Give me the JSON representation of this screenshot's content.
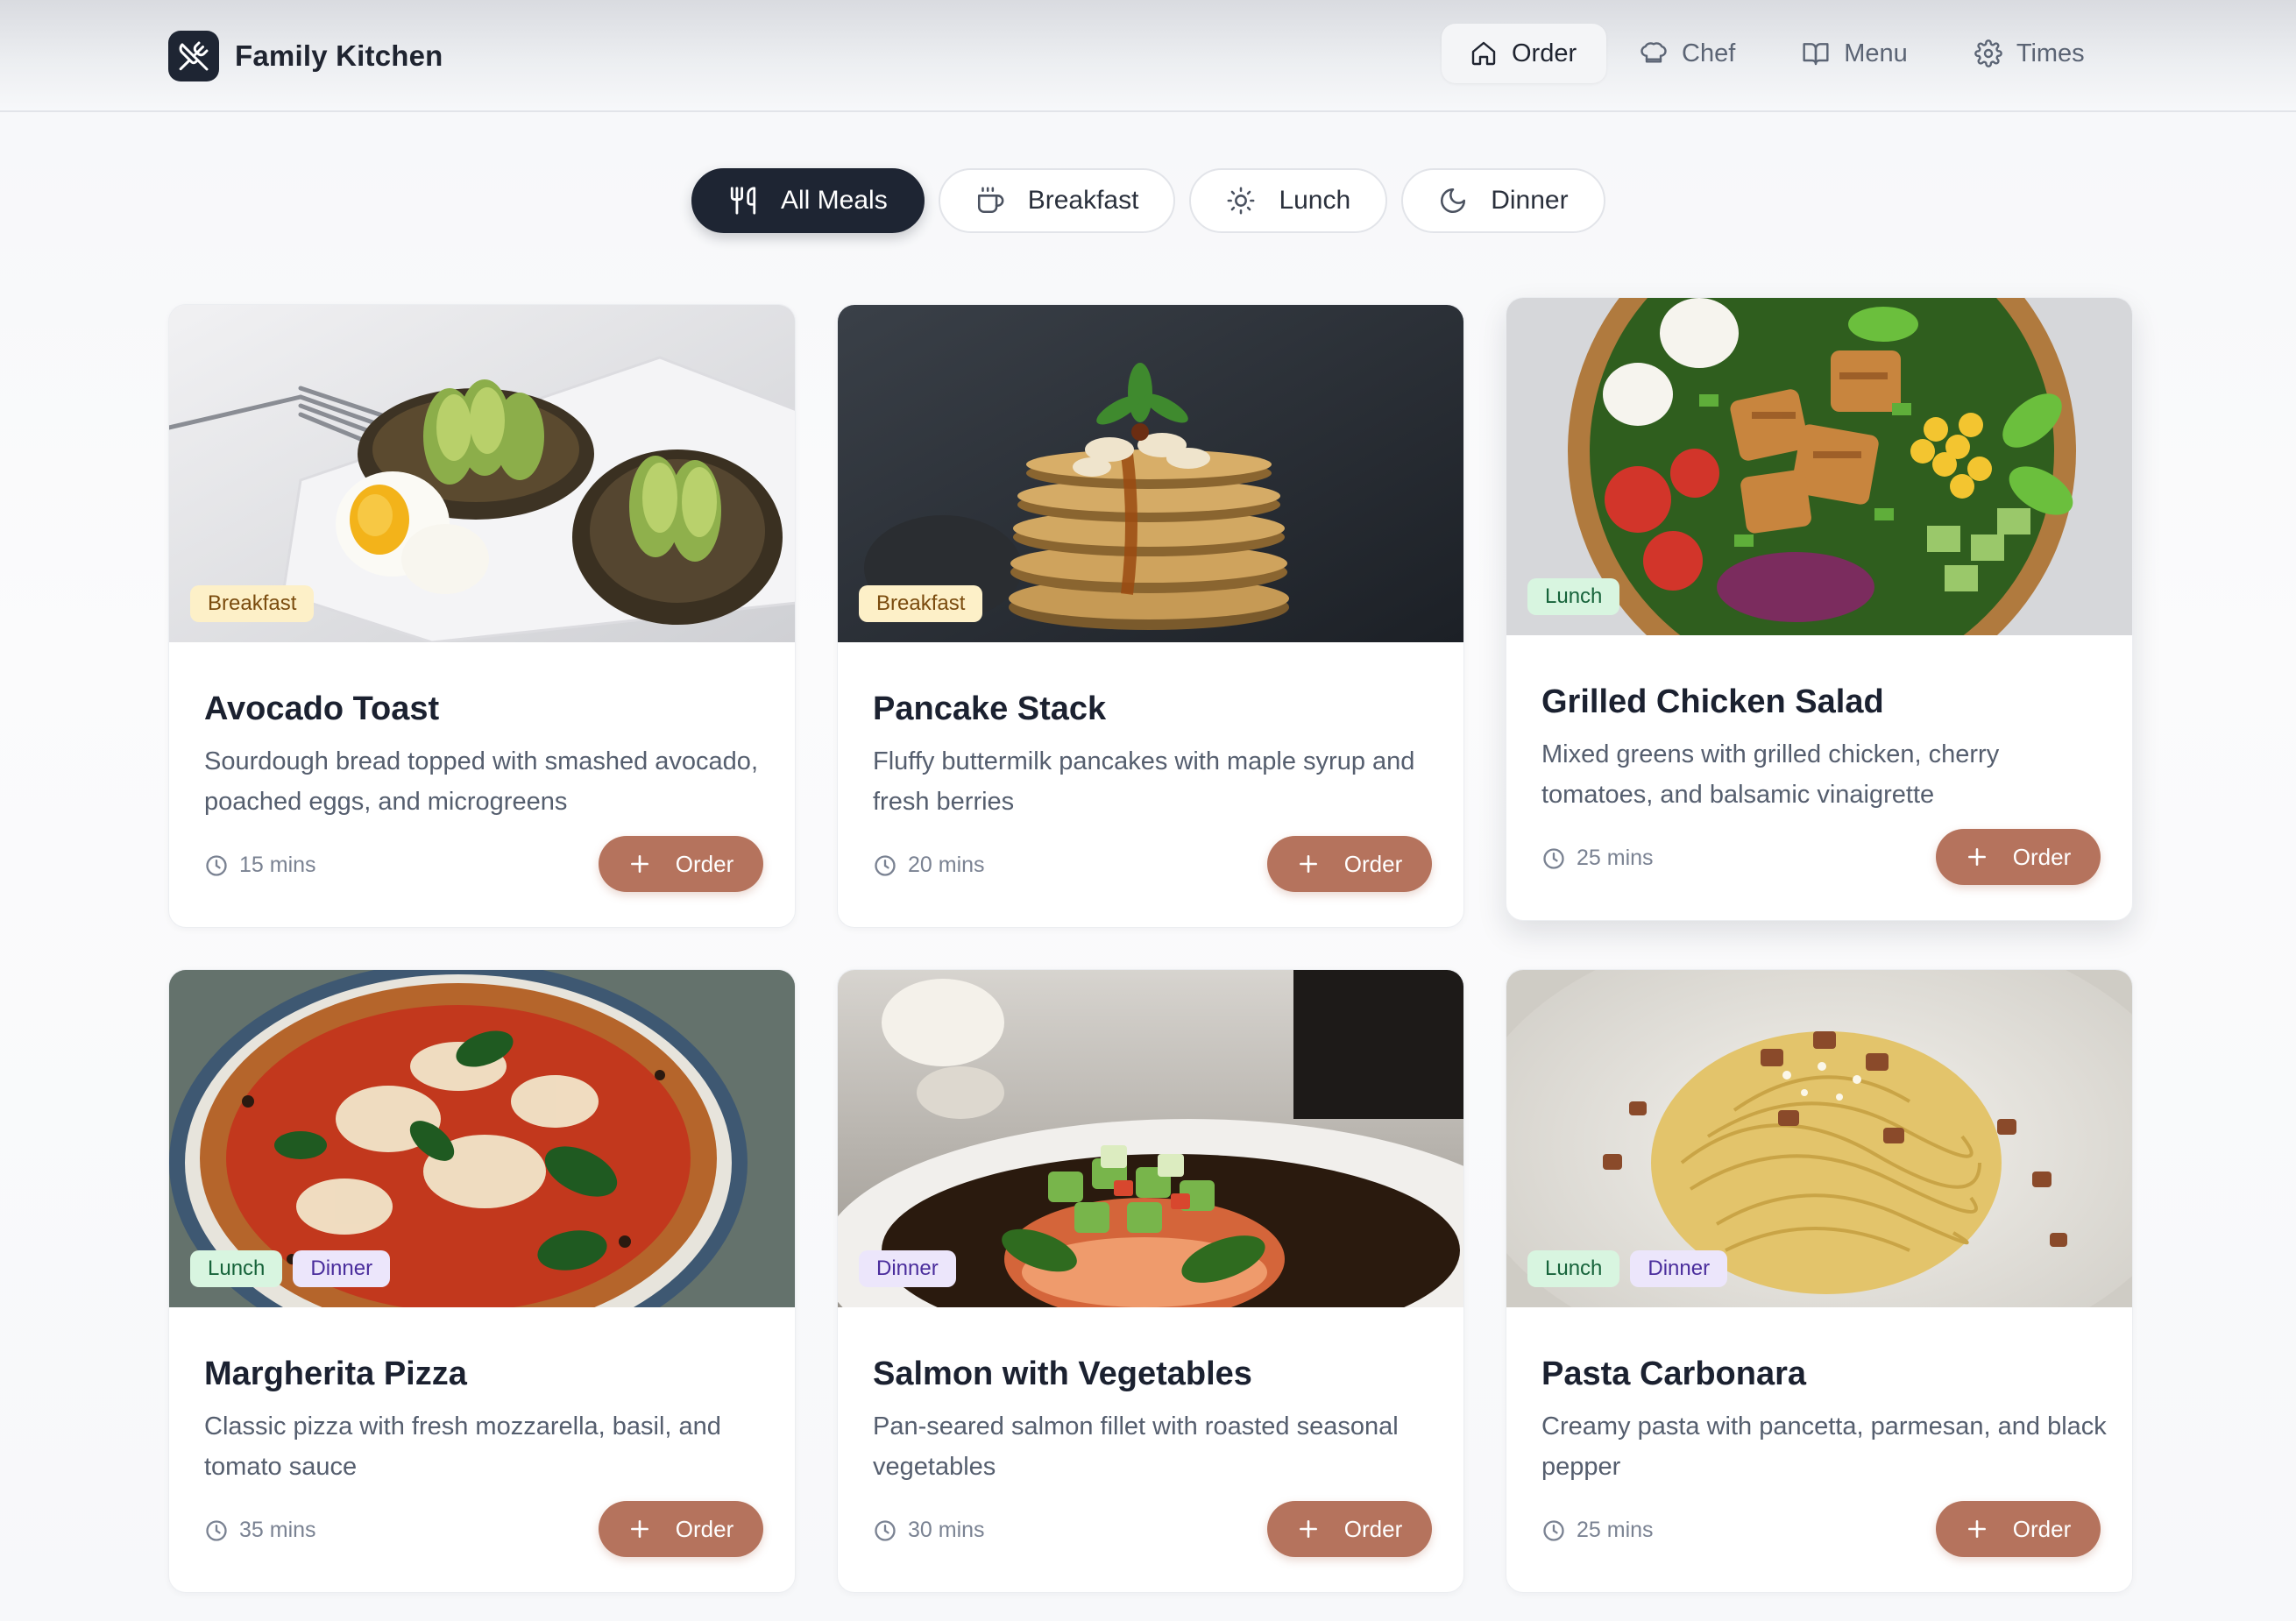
{
  "app": {
    "name": "Family Kitchen"
  },
  "nav": [
    {
      "label": "Order",
      "icon": "home-icon",
      "active": true
    },
    {
      "label": "Chef",
      "icon": "chef-hat-icon",
      "active": false
    },
    {
      "label": "Menu",
      "icon": "book-icon",
      "active": false
    },
    {
      "label": "Times",
      "icon": "gear-icon",
      "active": false
    }
  ],
  "filters": [
    {
      "label": "All Meals",
      "icon": "utensils-icon",
      "active": true
    },
    {
      "label": "Breakfast",
      "icon": "coffee-icon",
      "active": false
    },
    {
      "label": "Lunch",
      "icon": "sun-icon",
      "active": false
    },
    {
      "label": "Dinner",
      "icon": "moon-icon",
      "active": false
    }
  ],
  "cards": [
    {
      "title": "Avocado Toast",
      "description": "Sourdough bread topped with smashed avocado, poached eggs, and microgreens",
      "tags": [
        "Breakfast"
      ],
      "time": "15 mins",
      "button": "Order"
    },
    {
      "title": "Pancake Stack",
      "description": "Fluffy buttermilk pancakes with maple syrup and fresh berries",
      "tags": [
        "Breakfast"
      ],
      "time": "20 mins",
      "button": "Order"
    },
    {
      "title": "Grilled Chicken Salad",
      "description": "Mixed greens with grilled chicken, cherry tomatoes, and balsamic vinaigrette",
      "tags": [
        "Lunch"
      ],
      "time": "25 mins",
      "button": "Order"
    },
    {
      "title": "Margherita Pizza",
      "description": "Classic pizza with fresh mozzarella, basil, and tomato sauce",
      "tags": [
        "Lunch",
        "Dinner"
      ],
      "time": "35 mins",
      "button": "Order"
    },
    {
      "title": "Salmon with Vegetables",
      "description": "Pan-seared salmon fillet with roasted seasonal vegetables",
      "tags": [
        "Dinner"
      ],
      "time": "30 mins",
      "button": "Order"
    },
    {
      "title": "Pasta Carbonara",
      "description": "Creamy pasta with pancetta, parmesan, and black pepper",
      "tags": [
        "Lunch",
        "Dinner"
      ],
      "time": "25 mins",
      "button": "Order"
    }
  ],
  "colors": {
    "primary_dark": "#1e2533",
    "order_button": "#b5735d",
    "breakfast_tag": "#fdf0c8",
    "lunch_tag": "#d8f5e0",
    "dinner_tag": "#ece6fb"
  }
}
